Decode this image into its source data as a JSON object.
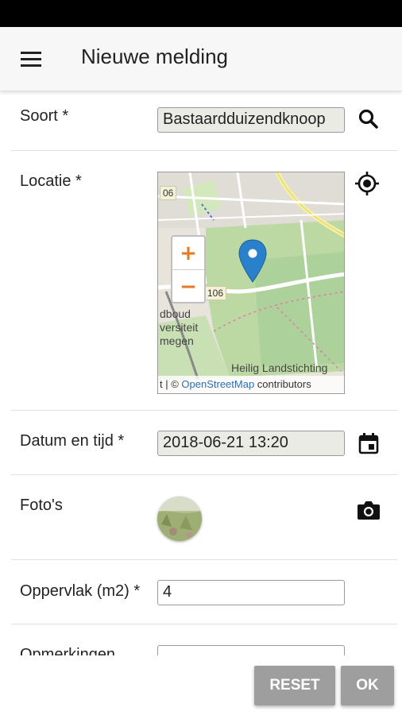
{
  "app_bar": {
    "title": "Nieuwe melding",
    "menu_icon": "hamburger-menu-icon"
  },
  "form": {
    "soort": {
      "label": "Soort *",
      "value": "Bastaardduizendknoop",
      "icon": "search-icon"
    },
    "locatie": {
      "label": "Locatie *",
      "icon": "gps-locate-icon",
      "map": {
        "zoom_in": "+",
        "zoom_out": "−",
        "road_label_top": "06",
        "road_label_mid": "106",
        "place_left_1": "dboud",
        "place_left_2": "versiteit",
        "place_left_3": "megen",
        "place_label": "Heilig Landstichting",
        "attribution_prefix": "t | © ",
        "attribution_link": "OpenStreetMap",
        "attribution_suffix": " contributors",
        "marker_color": "#2a81cb"
      }
    },
    "datum": {
      "label": "Datum en tijd *",
      "value": "2018-06-21 13:20",
      "icon": "calendar-icon"
    },
    "fotos": {
      "label": "Foto's",
      "icon": "camera-icon"
    },
    "oppervlak": {
      "label": "Oppervlak (m2) *",
      "value": "4"
    },
    "opmerkingen": {
      "label": "Opmerkingen"
    }
  },
  "buttons": {
    "reset": "RESET",
    "ok": "OK"
  },
  "colors": {
    "button_bg": "#9e9e9e",
    "zoom_accent": "#e87722",
    "field_readonly_bg": "#ebebe6"
  }
}
